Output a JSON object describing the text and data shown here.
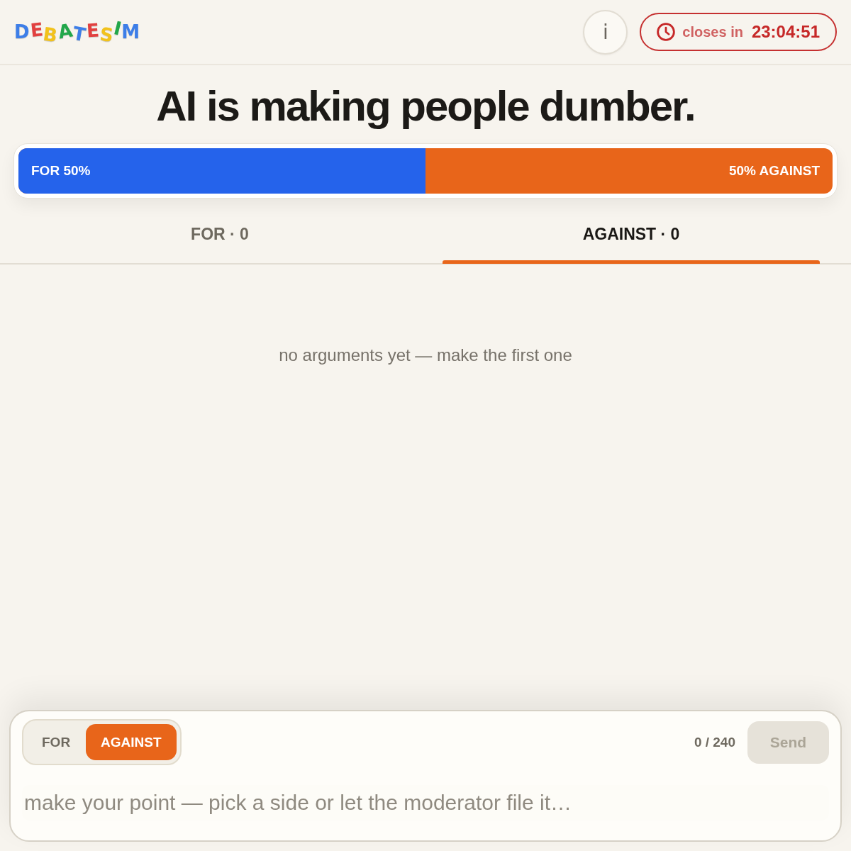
{
  "header": {
    "logo": [
      {
        "char": "D",
        "color": "#3d7ee8"
      },
      {
        "char": "E",
        "color": "#e2403f"
      },
      {
        "char": "B",
        "color": "#f2c21b"
      },
      {
        "char": "A",
        "color": "#22a74a"
      },
      {
        "char": "T",
        "color": "#3d7ee8"
      },
      {
        "char": "E",
        "color": "#e2403f"
      },
      {
        "char": "S",
        "color": "#f2c21b"
      },
      {
        "char": "I",
        "color": "#22a74a"
      },
      {
        "char": "M",
        "color": "#3d7ee8"
      }
    ],
    "info_button": {
      "label": "i"
    },
    "countdown": {
      "prefix": "closes in",
      "time": "23:04:51"
    }
  },
  "title": "AI is making people dumber.",
  "vote_bar": {
    "for_label": "FOR 50%",
    "against_label": "50% AGAINST",
    "level": 0.5
  },
  "tabs": [
    {
      "label": "FOR · 0",
      "selected": false
    },
    {
      "label": "AGAINST · 0",
      "selected": true
    }
  ],
  "empty_message": "no arguments yet — make the first one",
  "composer": {
    "sides": [
      {
        "label": "FOR",
        "selected": false
      },
      {
        "label": "AGAINST",
        "selected": true
      }
    ],
    "counter": "0 / 240",
    "send": {
      "label": "Send",
      "disabled": true
    },
    "placeholder": "make your point — pick a side or let the moderator file it…"
  }
}
